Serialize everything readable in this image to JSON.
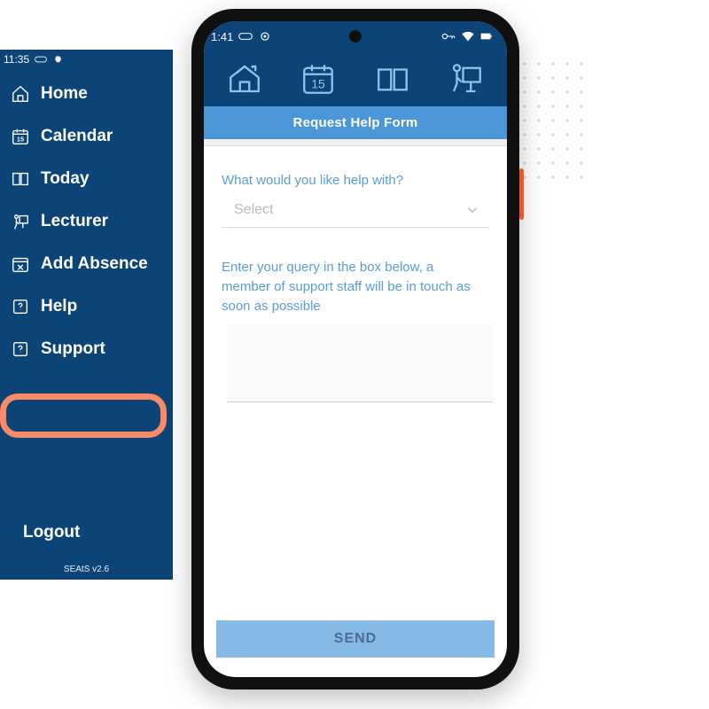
{
  "sidebar": {
    "status_time": "11:35",
    "menu": [
      {
        "label": "Home"
      },
      {
        "label": "Calendar"
      },
      {
        "label": "Today"
      },
      {
        "label": "Lecturer"
      },
      {
        "label": "Add Absence"
      },
      {
        "label": "Help"
      },
      {
        "label": "Support"
      }
    ],
    "logout_label": "Logout",
    "version": "SEAtS v2.6"
  },
  "phone": {
    "status_time": "1:41",
    "title": "Request Help Form",
    "form": {
      "topic_question": "What would you like help with?",
      "select_placeholder": "Select",
      "query_label": "Enter your query in the box below, a member of support staff will be in touch as soon as possible",
      "send_label": "SEND"
    }
  }
}
